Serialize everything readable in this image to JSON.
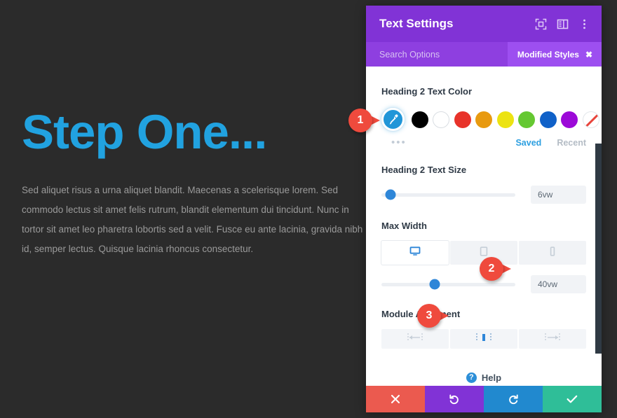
{
  "canvas": {
    "background_color": "#2b2b2b",
    "heading": "Step One...",
    "heading_color": "#21a2e0",
    "body_text": "Sed aliquet risus a urna aliquet blandit. Maecenas a scelerisque lorem. Sed commodo lectus sit amet felis rutrum, blandit elementum dui tincidunt. Nunc in tortor sit amet leo pharetra lobortis sed a velit. Fusce eu ante lacinia, gravida nibh id, semper lectus. Quisque lacinia rhoncus consectetur."
  },
  "panel": {
    "title": "Text Settings",
    "header_color": "#8133d6",
    "icons": [
      {
        "name": "expand-icon"
      },
      {
        "name": "layout-toggle-icon"
      },
      {
        "name": "more-options-icon"
      }
    ],
    "search": {
      "placeholder": "Search Options",
      "value": ""
    },
    "modified_badge": {
      "label": "Modified Styles",
      "close": "✖"
    },
    "sections": {
      "text_color": {
        "label": "Heading 2 Text Color",
        "eyedropper": {
          "name": "eyedropper-icon",
          "color": "#2196d8"
        },
        "swatches": [
          {
            "name": "swatch-black",
            "color": "#000000"
          },
          {
            "name": "swatch-white",
            "color": "#ffffff"
          },
          {
            "name": "swatch-red",
            "color": "#e8332a"
          },
          {
            "name": "swatch-orange",
            "color": "#e89a10"
          },
          {
            "name": "swatch-yellow",
            "color": "#ece312"
          },
          {
            "name": "swatch-green",
            "color": "#65c832"
          },
          {
            "name": "swatch-blue",
            "color": "#1061c8"
          },
          {
            "name": "swatch-purple",
            "color": "#9c09d8"
          },
          {
            "name": "swatch-transparent",
            "color": "none"
          }
        ],
        "more_dots": "•••",
        "tab_saved": "Saved",
        "tab_recent": "Recent",
        "active_tab": "Saved"
      },
      "text_size": {
        "label": "Heading 2 Text Size",
        "value": "6vw",
        "slider_percent": 7
      },
      "max_width": {
        "label": "Max Width",
        "devices": [
          {
            "name": "desktop-icon",
            "active": true
          },
          {
            "name": "tablet-icon",
            "active": false
          },
          {
            "name": "phone-icon",
            "active": false
          }
        ],
        "value": "40vw",
        "slider_percent": 40
      },
      "module_alignment": {
        "label": "Module Alignment",
        "options": [
          {
            "name": "align-left-icon",
            "active": false
          },
          {
            "name": "align-center-icon",
            "active": true
          },
          {
            "name": "align-right-icon",
            "active": false
          }
        ]
      },
      "help": {
        "label": "Help",
        "icon_glyph": "?"
      }
    },
    "footer": [
      {
        "name": "cancel-button",
        "glyph": "close",
        "color": "#eb5a4f"
      },
      {
        "name": "undo-button",
        "glyph": "undo",
        "color": "#8133d6"
      },
      {
        "name": "redo-button",
        "glyph": "redo",
        "color": "#2189cf"
      },
      {
        "name": "save-button",
        "glyph": "check",
        "color": "#2fbe98"
      }
    ]
  },
  "markers": [
    {
      "number": "1"
    },
    {
      "number": "2"
    },
    {
      "number": "3"
    }
  ]
}
